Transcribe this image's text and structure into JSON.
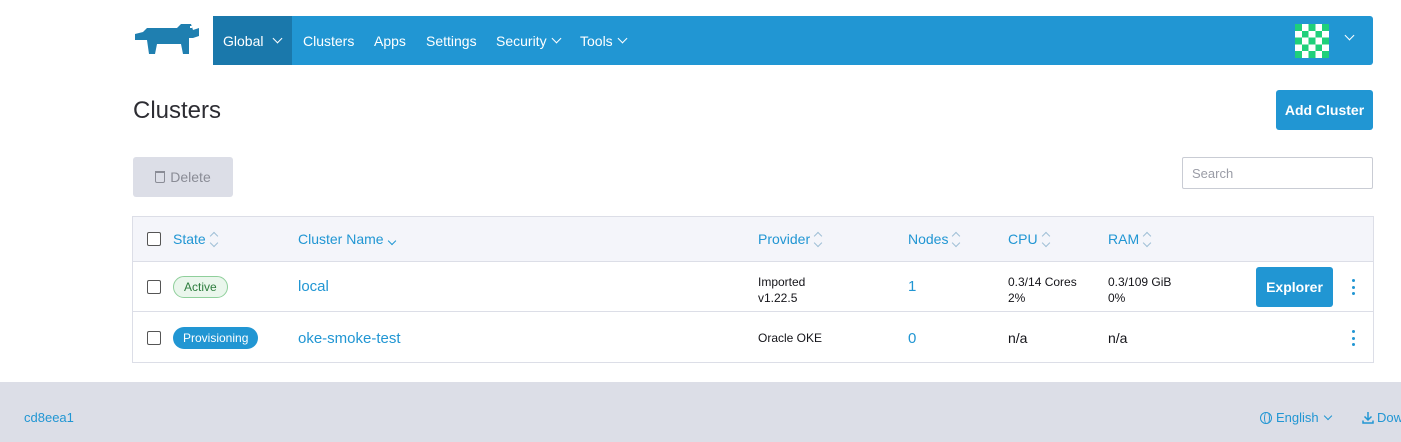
{
  "nav": {
    "global": "Global",
    "items": [
      "Clusters",
      "Apps",
      "Settings",
      "Security",
      "Tools"
    ]
  },
  "header": {
    "title": "Clusters",
    "add_button": "Add Cluster"
  },
  "toolbar": {
    "delete_label": "Delete",
    "search_placeholder": "Search"
  },
  "table": {
    "columns": [
      "State",
      "Cluster Name",
      "Provider",
      "Nodes",
      "CPU",
      "RAM"
    ],
    "rows": [
      {
        "state": "Active",
        "name": "local",
        "provider": "Imported",
        "provider_version": "v1.22.5",
        "nodes": "1",
        "cpu": "0.3/14 Cores",
        "cpu_pct": "2%",
        "ram": "0.3/109 GiB",
        "ram_pct": "0%",
        "action": "Explorer"
      },
      {
        "state": "Provisioning",
        "name": "oke-smoke-test",
        "provider": "Oracle OKE",
        "nodes": "0",
        "cpu": "n/a",
        "ram": "n/a"
      }
    ]
  },
  "footer": {
    "version": "cd8eea1",
    "language": "English",
    "download": "Dow"
  },
  "colors": {
    "primary": "#2196d3",
    "nav_active": "#1a78ab",
    "logo": "#1f7fb0"
  }
}
